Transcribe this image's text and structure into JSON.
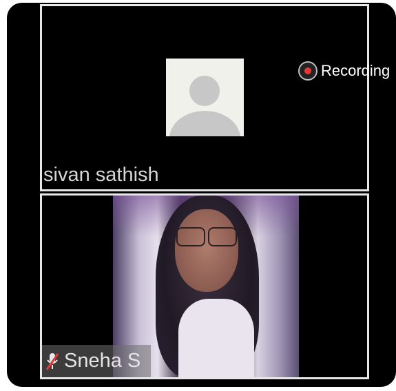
{
  "participants": [
    {
      "name": "sivan sathish",
      "video": false,
      "muted": false
    },
    {
      "name": "Sneha S",
      "video": true,
      "muted": true
    }
  ],
  "recording": {
    "label": "Recording",
    "color": "#e53935"
  },
  "colors": {
    "background": "#000000",
    "tile_border": "#e8e8e8",
    "name_text": "#d6d6d6"
  },
  "icons": {
    "avatar": "person-placeholder-icon",
    "recording": "record-dot-icon",
    "mic": "mic-muted-icon"
  }
}
